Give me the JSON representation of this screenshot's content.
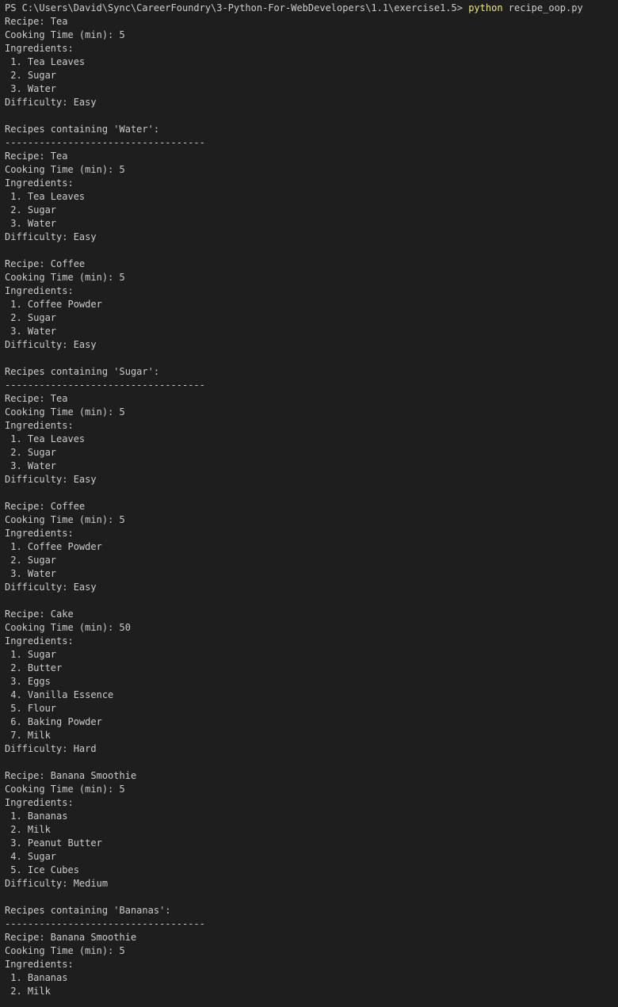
{
  "terminal": {
    "colors": {
      "background": "#1e1e1e",
      "foreground": "#cccccc",
      "command": "#f0e68c"
    },
    "prompt": {
      "prefix": "PS C:\\Users\\David\\Sync\\CareerFoundry\\3-Python-For-WebDevelopers\\1.1\\exercise1.5> ",
      "command": "python",
      "args": " recipe_oop.py"
    },
    "output_lines": [
      "Recipe: Tea",
      "Cooking Time (min): 5",
      "Ingredients:",
      " 1. Tea Leaves",
      " 2. Sugar",
      " 3. Water",
      "Difficulty: Easy",
      "",
      "Recipes containing 'Water':",
      "-----------------------------------",
      "Recipe: Tea",
      "Cooking Time (min): 5",
      "Ingredients:",
      " 1. Tea Leaves",
      " 2. Sugar",
      " 3. Water",
      "Difficulty: Easy",
      "",
      "Recipe: Coffee",
      "Cooking Time (min): 5",
      "Ingredients:",
      " 1. Coffee Powder",
      " 2. Sugar",
      " 3. Water",
      "Difficulty: Easy",
      "",
      "Recipes containing 'Sugar':",
      "-----------------------------------",
      "Recipe: Tea",
      "Cooking Time (min): 5",
      "Ingredients:",
      " 1. Tea Leaves",
      " 2. Sugar",
      " 3. Water",
      "Difficulty: Easy",
      "",
      "Recipe: Coffee",
      "Cooking Time (min): 5",
      "Ingredients:",
      " 1. Coffee Powder",
      " 2. Sugar",
      " 3. Water",
      "Difficulty: Easy",
      "",
      "Recipe: Cake",
      "Cooking Time (min): 50",
      "Ingredients:",
      " 1. Sugar",
      " 2. Butter",
      " 3. Eggs",
      " 4. Vanilla Essence",
      " 5. Flour",
      " 6. Baking Powder",
      " 7. Milk",
      "Difficulty: Hard",
      "",
      "Recipe: Banana Smoothie",
      "Cooking Time (min): 5",
      "Ingredients:",
      " 1. Bananas",
      " 2. Milk",
      " 3. Peanut Butter",
      " 4. Sugar",
      " 5. Ice Cubes",
      "Difficulty: Medium",
      "",
      "Recipes containing 'Bananas':",
      "-----------------------------------",
      "Recipe: Banana Smoothie",
      "Cooking Time (min): 5",
      "Ingredients:",
      " 1. Bananas",
      " 2. Milk"
    ]
  }
}
